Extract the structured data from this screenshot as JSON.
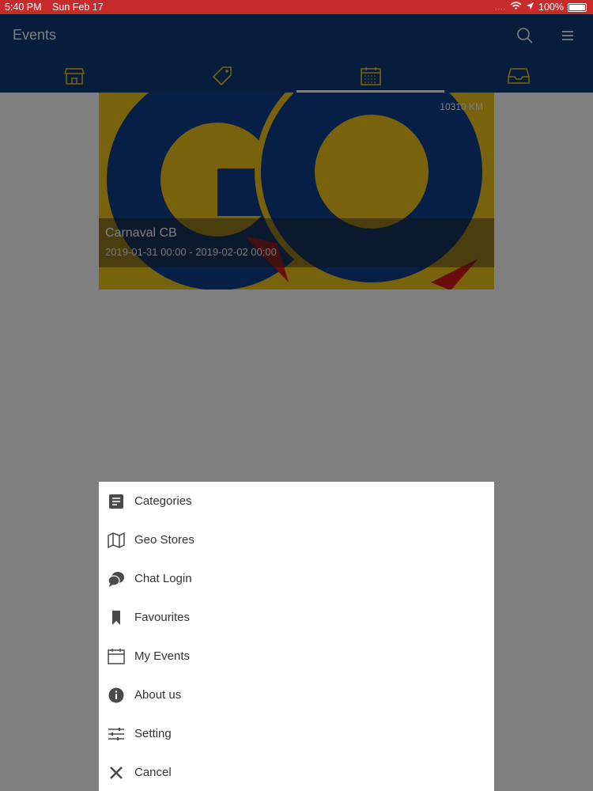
{
  "status_bar": {
    "time": "5:40 PM",
    "date": "Sun Feb 17",
    "signal": "....",
    "battery": "100%"
  },
  "header": {
    "title": "Events",
    "tabs": [
      {
        "name": "stores",
        "icon": "store-icon"
      },
      {
        "name": "offers",
        "icon": "tag-icon"
      },
      {
        "name": "events",
        "icon": "calendar-icon",
        "active": true
      },
      {
        "name": "inbox",
        "icon": "inbox-icon"
      }
    ]
  },
  "event_card": {
    "logo_text": "GO",
    "distance": "10310 KM",
    "name": "Carnaval CB",
    "dates": "2019-01-31 00:00 - 2019-02-02 00:00"
  },
  "menu": {
    "items": [
      {
        "label": "Categories",
        "icon": "list-icon"
      },
      {
        "label": "Geo Stores",
        "icon": "map-icon"
      },
      {
        "label": "Chat Login",
        "icon": "chat-icon"
      },
      {
        "label": "Favourites",
        "icon": "bookmark-icon"
      },
      {
        "label": "My Events",
        "icon": "calendar-icon"
      },
      {
        "label": "About us",
        "icon": "info-icon"
      },
      {
        "label": "Setting",
        "icon": "sliders-icon"
      },
      {
        "label": "Cancel",
        "icon": "close-icon"
      }
    ]
  },
  "colors": {
    "status_bar": "#c62c2c",
    "header": "#0d3c78",
    "accent": "#f0c419",
    "logo_blue": "#0b3f8c",
    "arrow_red": "#d81b1b"
  }
}
